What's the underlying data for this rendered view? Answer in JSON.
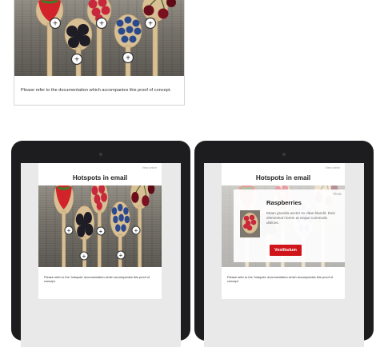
{
  "top_email": {
    "note": "Please refer to the documentation which accompanies this proof of concept."
  },
  "tablet_left": {
    "view_online": "View online",
    "title": "Hotspots in email",
    "note": "Please refer to the 'hotspots' documentation which accompanies this proof of concept."
  },
  "tablet_right": {
    "view_online": "View online",
    "title": "Hotspots in email",
    "note": "Please refer to the 'hotspots' documentation which accompanies this proof of concept.",
    "popup": {
      "close": "Close",
      "title": "Raspberries",
      "body": "Etiam gravida auctor ex vitae blandit. Duis elementum lorem at neque commodo ultrices.",
      "button": "Vestibulum"
    }
  },
  "hotspot_symbol": "+",
  "colors": {
    "button_red": "#d0141b",
    "tablet_frame": "#1d1d1f",
    "wood": "#6f6b63"
  }
}
